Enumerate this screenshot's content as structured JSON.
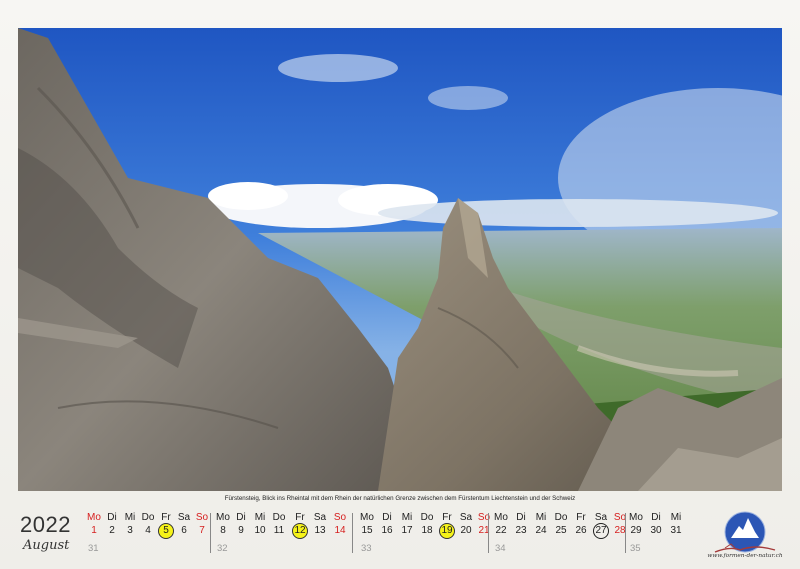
{
  "caption": "Fürstensteig, Blick ins Rheintal mit dem Rhein der natürlichen Grenze zwischen dem Fürstentum Liechtenstein und der Schweiz",
  "year": "2022",
  "month": "August",
  "weekday_labels": [
    "Mo",
    "Di",
    "Mi",
    "Do",
    "Fr",
    "Sa",
    "So"
  ],
  "weeks": [
    {
      "kw": "31",
      "days": [
        "1",
        "2",
        "3",
        "4",
        "5",
        "6",
        "7"
      ],
      "dows": [
        "Mo",
        "Di",
        "Mi",
        "Do",
        "Fr",
        "Sa",
        "So"
      ]
    },
    {
      "kw": "32",
      "days": [
        "8",
        "9",
        "10",
        "11",
        "12",
        "13",
        "14"
      ],
      "dows": [
        "Mo",
        "Di",
        "Mi",
        "Do",
        "Fr",
        "Sa",
        "So"
      ]
    },
    {
      "kw": "33",
      "days": [
        "15",
        "16",
        "17",
        "18",
        "19",
        "20",
        "21"
      ],
      "dows": [
        "Mo",
        "Di",
        "Mi",
        "Do",
        "Fr",
        "Sa",
        "So"
      ]
    },
    {
      "kw": "34",
      "days": [
        "22",
        "23",
        "24",
        "25",
        "26",
        "27",
        "28"
      ],
      "dows": [
        "Mo",
        "Di",
        "Mi",
        "Do",
        "Fr",
        "Sa",
        "So"
      ]
    },
    {
      "kw": "35",
      "days": [
        "29",
        "30",
        "31"
      ],
      "dows": [
        "Mo",
        "Di",
        "Mi"
      ]
    }
  ],
  "highlighted_days": [
    "5",
    "12",
    "19"
  ],
  "circled_days": [
    "27"
  ],
  "logo_url": "www.formen-der-natur.ch",
  "colors": {
    "holiday_red": "#d61f1f",
    "highlight_yellow": "#f6f31a",
    "sky_blue": "#2f63c8"
  }
}
